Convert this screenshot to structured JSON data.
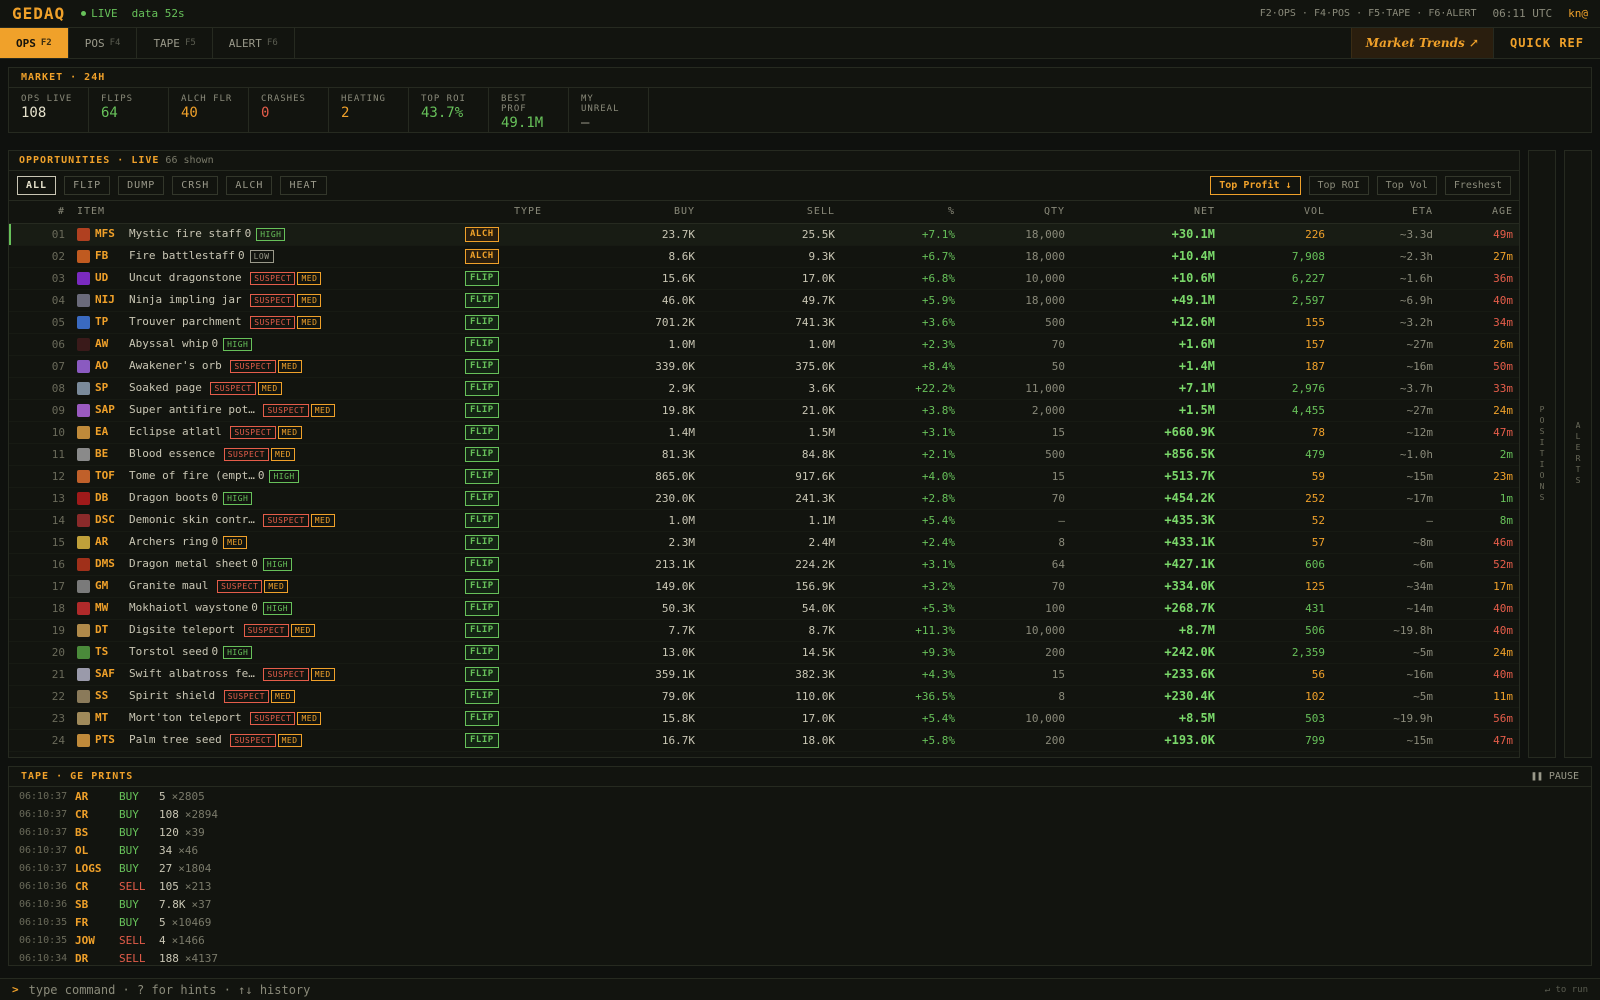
{
  "app": {
    "logo": "GEDAQ",
    "live": "LIVE",
    "data_age": "data 52s",
    "hotkeys": "F2·OPS · F4·POS · F5·TAPE · F6·ALERT",
    "clock": "06:11 UTC",
    "user": "kn@"
  },
  "tabs": [
    {
      "label": "OPS",
      "key": "F2",
      "active": true
    },
    {
      "label": "POS",
      "key": "F4"
    },
    {
      "label": "TAPE",
      "key": "F5"
    },
    {
      "label": "ALERT",
      "key": "F6"
    }
  ],
  "trends": {
    "label": "Market Trends ↗"
  },
  "quick_ref": {
    "label": "QUICK REF"
  },
  "market": {
    "title": "MARKET · 24H",
    "stats": [
      {
        "label": "OPS LIVE",
        "value": "108",
        "color": "#e6e2cc"
      },
      {
        "label": "FLIPS",
        "value": "64",
        "color": "#67c15a"
      },
      {
        "label": "ALCH FLR",
        "value": "40",
        "color": "#f0a12a"
      },
      {
        "label": "CRASHES",
        "value": "0",
        "color": "#e55d4a"
      },
      {
        "label": "HEATING",
        "value": "2",
        "color": "#f0a12a"
      },
      {
        "label": "TOP ROI",
        "value": "43.7%",
        "color": "#67c15a"
      },
      {
        "label": "BEST PROF",
        "value": "49.1M",
        "color": "#67c15a"
      },
      {
        "label": "MY UNREAL",
        "value": "—",
        "color": "#9a998a"
      }
    ]
  },
  "opps": {
    "title": "OPPORTUNITIES · LIVE",
    "shown": "66 shown",
    "filters": [
      "ALL",
      "FLIP",
      "DUMP",
      "CRSH",
      "ALCH",
      "HEAT"
    ],
    "sorts": [
      "Top Profit ↓",
      "Top ROI",
      "Top Vol",
      "Freshest"
    ],
    "columns": {
      "num": "#",
      "item": "ITEM",
      "type": "TYPE",
      "buy": "BUY",
      "sell": "SELL",
      "pct": "%",
      "qty": "QTY",
      "net": "NET",
      "vol": "VOL",
      "eta": "ETA",
      "age": "AGE"
    },
    "rows": [
      {
        "n": "01",
        "code": "MFS",
        "name": "Mystic fire staff",
        "z": "0",
        "tags": [
          "HIGH"
        ],
        "type": "ALCH",
        "buy": "23.7K",
        "sell": "25.5K",
        "pct": "+7.1%",
        "qty": "18,000",
        "net": "+30.1M",
        "vol": "226",
        "eta": "~3.3d",
        "age": "49m",
        "ic": "#b04020"
      },
      {
        "n": "02",
        "code": "FB",
        "name": "Fire battlestaff",
        "z": "0",
        "tags": [
          "LOW"
        ],
        "type": "ALCH",
        "buy": "8.6K",
        "sell": "9.3K",
        "pct": "+6.7%",
        "qty": "18,000",
        "net": "+10.4M",
        "vol": "7,908",
        "eta": "~2.3h",
        "age": "27m",
        "ic": "#c05a20"
      },
      {
        "n": "03",
        "code": "UD",
        "name": "Uncut dragonstone",
        "z": "",
        "tags": [
          "SUSPECT",
          "MED"
        ],
        "type": "FLIP",
        "buy": "15.6K",
        "sell": "17.0K",
        "pct": "+6.8%",
        "qty": "10,000",
        "net": "+10.6M",
        "vol": "6,227",
        "eta": "~1.6h",
        "age": "36m",
        "ic": "#7a2ac0"
      },
      {
        "n": "04",
        "code": "NIJ",
        "name": "Ninja impling jar",
        "z": "",
        "tags": [
          "SUSPECT",
          "MED"
        ],
        "type": "FLIP",
        "buy": "46.0K",
        "sell": "49.7K",
        "pct": "+5.9%",
        "qty": "18,000",
        "net": "+49.1M",
        "vol": "2,597",
        "eta": "~6.9h",
        "age": "40m",
        "ic": "#6a6a7a"
      },
      {
        "n": "05",
        "code": "TP",
        "name": "Trouver parchment",
        "z": "",
        "tags": [
          "SUSPECT",
          "MED"
        ],
        "type": "FLIP",
        "buy": "701.2K",
        "sell": "741.3K",
        "pct": "+3.6%",
        "qty": "500",
        "net": "+12.6M",
        "vol": "155",
        "eta": "~3.2h",
        "age": "34m",
        "ic": "#3a6ac0"
      },
      {
        "n": "06",
        "code": "AW",
        "name": "Abyssal whip",
        "z": "0",
        "tags": [
          "HIGH"
        ],
        "type": "FLIP",
        "buy": "1.0M",
        "sell": "1.0M",
        "pct": "+2.3%",
        "qty": "70",
        "net": "+1.6M",
        "vol": "157",
        "eta": "~27m",
        "age": "26m",
        "ic": "#3a1a1a"
      },
      {
        "n": "07",
        "code": "AO",
        "name": "Awakener's orb",
        "z": "",
        "tags": [
          "SUSPECT",
          "MED"
        ],
        "type": "FLIP",
        "buy": "339.0K",
        "sell": "375.0K",
        "pct": "+8.4%",
        "qty": "50",
        "net": "+1.4M",
        "vol": "187",
        "eta": "~16m",
        "age": "50m",
        "ic": "#8a5ac0"
      },
      {
        "n": "08",
        "code": "SP",
        "name": "Soaked page",
        "z": "",
        "tags": [
          "SUSPECT",
          "MED"
        ],
        "type": "FLIP",
        "buy": "2.9K",
        "sell": "3.6K",
        "pct": "+22.2%",
        "qty": "11,000",
        "net": "+7.1M",
        "vol": "2,976",
        "eta": "~3.7h",
        "age": "33m",
        "ic": "#7a8a9a"
      },
      {
        "n": "09",
        "code": "SAP",
        "name": "Super antifire pot…",
        "z": "",
        "tags": [
          "SUSPECT",
          "MED"
        ],
        "type": "FLIP",
        "buy": "19.8K",
        "sell": "21.0K",
        "pct": "+3.8%",
        "qty": "2,000",
        "net": "+1.5M",
        "vol": "4,455",
        "eta": "~27m",
        "age": "24m",
        "ic": "#9a5ac0"
      },
      {
        "n": "10",
        "code": "EA",
        "name": "Eclipse atlatl",
        "z": "",
        "tags": [
          "SUSPECT",
          "MED"
        ],
        "type": "FLIP",
        "buy": "1.4M",
        "sell": "1.5M",
        "pct": "+3.1%",
        "qty": "15",
        "net": "+660.9K",
        "vol": "78",
        "eta": "~12m",
        "age": "47m",
        "ic": "#c08a3a"
      },
      {
        "n": "11",
        "code": "BE",
        "name": "Blood essence",
        "z": "",
        "tags": [
          "SUSPECT",
          "MED"
        ],
        "type": "FLIP",
        "buy": "81.3K",
        "sell": "84.8K",
        "pct": "+2.1%",
        "qty": "500",
        "net": "+856.5K",
        "vol": "479",
        "eta": "~1.0h",
        "age": "2m",
        "ic": "#8a8a8a"
      },
      {
        "n": "12",
        "code": "TOF",
        "name": "Tome of fire (empt…",
        "z": "0",
        "tags": [
          "HIGH"
        ],
        "type": "FLIP",
        "buy": "865.0K",
        "sell": "917.6K",
        "pct": "+4.0%",
        "qty": "15",
        "net": "+513.7K",
        "vol": "59",
        "eta": "~15m",
        "age": "23m",
        "ic": "#c0602a"
      },
      {
        "n": "13",
        "code": "DB",
        "name": "Dragon boots",
        "z": "0",
        "tags": [
          "HIGH"
        ],
        "type": "FLIP",
        "buy": "230.0K",
        "sell": "241.3K",
        "pct": "+2.8%",
        "qty": "70",
        "net": "+454.2K",
        "vol": "252",
        "eta": "~17m",
        "age": "1m",
        "ic": "#a01a1a"
      },
      {
        "n": "14",
        "code": "DSC",
        "name": "Demonic skin contr…",
        "z": "",
        "tags": [
          "SUSPECT",
          "MED"
        ],
        "type": "FLIP",
        "buy": "1.0M",
        "sell": "1.1M",
        "pct": "+5.4%",
        "qty": "—",
        "net": "+435.3K",
        "vol": "52",
        "eta": "—",
        "age": "8m",
        "ic": "#8a2a2a"
      },
      {
        "n": "15",
        "code": "AR",
        "name": "Archers ring",
        "z": "0",
        "tags": [
          "MED"
        ],
        "type": "FLIP",
        "buy": "2.3M",
        "sell": "2.4M",
        "pct": "+2.4%",
        "qty": "8",
        "net": "+433.1K",
        "vol": "57",
        "eta": "~8m",
        "age": "46m",
        "ic": "#c0a03a"
      },
      {
        "n": "16",
        "code": "DMS",
        "name": "Dragon metal sheet",
        "z": "0",
        "tags": [
          "HIGH"
        ],
        "type": "FLIP",
        "buy": "213.1K",
        "sell": "224.2K",
        "pct": "+3.1%",
        "qty": "64",
        "net": "+427.1K",
        "vol": "606",
        "eta": "~6m",
        "age": "52m",
        "ic": "#a0301a"
      },
      {
        "n": "17",
        "code": "GM",
        "name": "Granite maul",
        "z": "",
        "tags": [
          "SUSPECT",
          "MED"
        ],
        "type": "FLIP",
        "buy": "149.0K",
        "sell": "156.9K",
        "pct": "+3.2%",
        "qty": "70",
        "net": "+334.0K",
        "vol": "125",
        "eta": "~34m",
        "age": "17m",
        "ic": "#7a7a7a"
      },
      {
        "n": "18",
        "code": "MW",
        "name": "Mokhaiotl waystone",
        "z": "0",
        "tags": [
          "HIGH"
        ],
        "type": "FLIP",
        "buy": "50.3K",
        "sell": "54.0K",
        "pct": "+5.3%",
        "qty": "100",
        "net": "+268.7K",
        "vol": "431",
        "eta": "~14m",
        "age": "40m",
        "ic": "#b02a2a"
      },
      {
        "n": "19",
        "code": "DT",
        "name": "Digsite teleport",
        "z": "",
        "tags": [
          "SUSPECT",
          "MED"
        ],
        "type": "FLIP",
        "buy": "7.7K",
        "sell": "8.7K",
        "pct": "+11.3%",
        "qty": "10,000",
        "net": "+8.7M",
        "vol": "506",
        "eta": "~19.8h",
        "age": "40m",
        "ic": "#b08a4a"
      },
      {
        "n": "20",
        "code": "TS",
        "name": "Torstol seed",
        "z": "0",
        "tags": [
          "HIGH"
        ],
        "type": "FLIP",
        "buy": "13.0K",
        "sell": "14.5K",
        "pct": "+9.3%",
        "qty": "200",
        "net": "+242.0K",
        "vol": "2,359",
        "eta": "~5m",
        "age": "24m",
        "ic": "#4a8a3a"
      },
      {
        "n": "21",
        "code": "SAF",
        "name": "Swift albatross fe…",
        "z": "",
        "tags": [
          "SUSPECT",
          "MED"
        ],
        "type": "FLIP",
        "buy": "359.1K",
        "sell": "382.3K",
        "pct": "+4.3%",
        "qty": "15",
        "net": "+233.6K",
        "vol": "56",
        "eta": "~16m",
        "age": "40m",
        "ic": "#9a9aaa"
      },
      {
        "n": "22",
        "code": "SS",
        "name": "Spirit shield",
        "z": "",
        "tags": [
          "SUSPECT",
          "MED"
        ],
        "type": "FLIP",
        "buy": "79.0K",
        "sell": "110.0K",
        "pct": "+36.5%",
        "qty": "8",
        "net": "+230.4K",
        "vol": "102",
        "eta": "~5m",
        "age": "11m",
        "ic": "#8a7a5a"
      },
      {
        "n": "23",
        "code": "MT",
        "name": "Mort'ton teleport",
        "z": "",
        "tags": [
          "SUSPECT",
          "MED"
        ],
        "type": "FLIP",
        "buy": "15.8K",
        "sell": "17.0K",
        "pct": "+5.4%",
        "qty": "10,000",
        "net": "+8.5M",
        "vol": "503",
        "eta": "~19.9h",
        "age": "56m",
        "ic": "#a08a5a"
      },
      {
        "n": "24",
        "code": "PTS",
        "name": "Palm tree seed",
        "z": "",
        "tags": [
          "SUSPECT",
          "MED"
        ],
        "type": "FLIP",
        "buy": "16.7K",
        "sell": "18.0K",
        "pct": "+5.8%",
        "qty": "200",
        "net": "+193.0K",
        "vol": "799",
        "eta": "~15m",
        "age": "47m",
        "ic": "#c08a3a"
      }
    ]
  },
  "side_positions": "POSITIONS",
  "side_alerts": "ALERTS",
  "tape": {
    "title": "TAPE · GE PRINTS",
    "pause": "PAUSE",
    "rows": [
      {
        "t": "06:10:37",
        "s": "AR",
        "side": "BUY",
        "p": "5",
        "q": "×2805"
      },
      {
        "t": "06:10:37",
        "s": "CR",
        "side": "BUY",
        "p": "108",
        "q": "×2894"
      },
      {
        "t": "06:10:37",
        "s": "BS",
        "side": "BUY",
        "p": "120",
        "q": "×39"
      },
      {
        "t": "06:10:37",
        "s": "OL",
        "side": "BUY",
        "p": "34",
        "q": "×46"
      },
      {
        "t": "06:10:37",
        "s": "LOGS",
        "side": "BUY",
        "p": "27",
        "q": "×1804"
      },
      {
        "t": "06:10:36",
        "s": "CR",
        "side": "SELL",
        "p": "105",
        "q": "×213"
      },
      {
        "t": "06:10:36",
        "s": "SB",
        "side": "BUY",
        "p": "7.8K",
        "q": "×37"
      },
      {
        "t": "06:10:35",
        "s": "FR",
        "side": "BUY",
        "p": "5",
        "q": "×10469"
      },
      {
        "t": "06:10:35",
        "s": "JOW",
        "side": "SELL",
        "p": "4",
        "q": "×1466"
      },
      {
        "t": "06:10:34",
        "s": "DR",
        "side": "SELL",
        "p": "188",
        "q": "×4137"
      }
    ]
  },
  "command": {
    "prompt": ">",
    "placeholder": "type command · ? for hints · ↑↓ history",
    "hint": "↵ to run"
  }
}
